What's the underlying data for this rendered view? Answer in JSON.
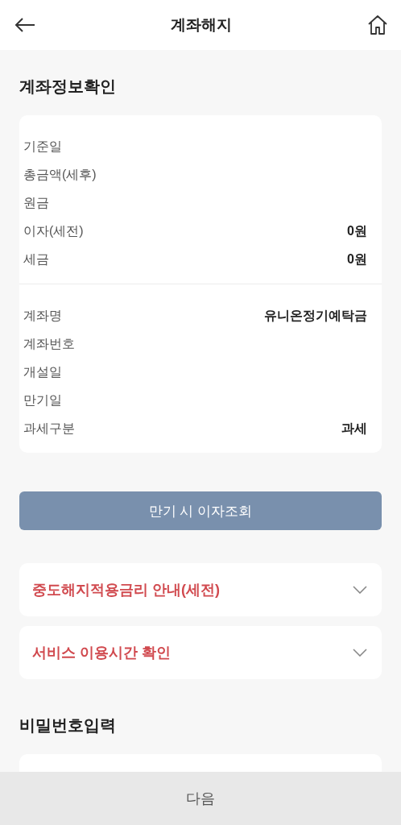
{
  "header": {
    "title": "계좌해지"
  },
  "account_info": {
    "title": "계좌정보확인",
    "groups": [
      {
        "rows": [
          {
            "label": "기준일"
          },
          {
            "label": "총금액(세후)"
          },
          {
            "label": "원금"
          },
          {
            "label": "이자(세전)",
            "value": "0원"
          },
          {
            "label": "세금",
            "value": "0원"
          }
        ]
      },
      {
        "rows": [
          {
            "label": "계좌명",
            "value": "유니온정기예탁금"
          },
          {
            "label": "계좌번호"
          },
          {
            "label": "개설일"
          },
          {
            "label": "만기일"
          },
          {
            "label": "과세구분",
            "value": "과세"
          }
        ]
      }
    ]
  },
  "interest_button": "만기 시 이자조회",
  "accordions": [
    {
      "label": "중도해지적용금리 안내(세전)",
      "expanded": false
    },
    {
      "label": "서비스 이용시간 확인",
      "expanded": false
    }
  ],
  "password": {
    "title": "비밀번호입력"
  },
  "next_button": "다음"
}
